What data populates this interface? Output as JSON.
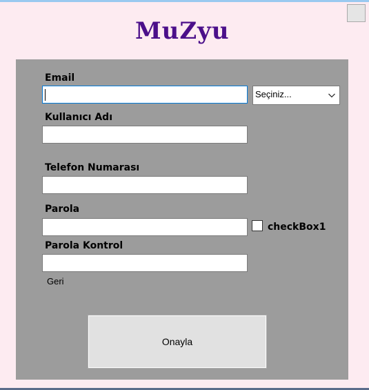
{
  "window": {
    "title": "MuZyu",
    "corner_button": "window-square-button"
  },
  "form": {
    "email_label": "Email",
    "email_value": "",
    "domain_select": {
      "selected": "Seçiniz...",
      "icon": "chevron-down-icon"
    },
    "username_label": "Kullanıcı Adı",
    "username_value": "",
    "phone_label": "Telefon Numarası",
    "phone_value": "",
    "password_label": "Parola",
    "password_value": "",
    "checkbox_label": "checkBox1",
    "checkbox_checked": false,
    "password_confirm_label": "Parola Kontrol",
    "password_confirm_value": "",
    "back_link": "Geri",
    "submit_label": "Onayla"
  },
  "colors": {
    "background": "#fdebf1",
    "panel": "#9c9c9c",
    "title": "#4b0f8a",
    "focus_border": "#0078d7"
  }
}
